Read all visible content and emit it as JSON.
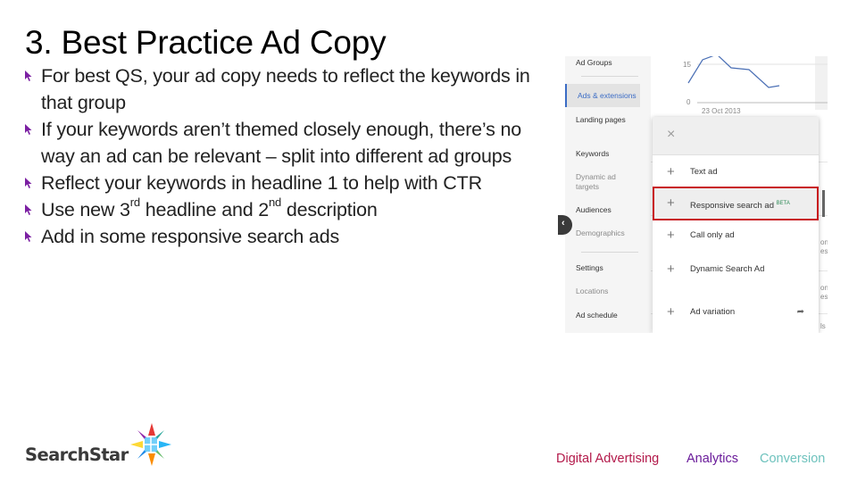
{
  "slide": {
    "title": "3. Best Practice Ad Copy",
    "bullet_color": "#7b1fa2",
    "bullets": [
      {
        "text": "For best QS, your ad copy needs to reflect the keywords in that group"
      },
      {
        "text": "If your keywords aren’t themed closely enough, there’s no way an ad can be relevant – split into different ad groups"
      },
      {
        "text": "Reflect your keywords in headline 1 to help with CTR"
      },
      {
        "pre": "Use new 3",
        "sup1": "rd",
        "mid": " headline and 2",
        "sup2": "nd",
        "post": " description"
      },
      {
        "text": "Add in some responsive search ads"
      }
    ]
  },
  "screenshot": {
    "sidebar": {
      "items": [
        {
          "label": "Ad Groups"
        },
        {
          "label": "Ads & extensions",
          "active": true
        },
        {
          "label": "Landing pages"
        },
        {
          "label": "Keywords"
        },
        {
          "label": "Dynamic ad targets"
        },
        {
          "label": "Audiences"
        },
        {
          "label": "Demographics"
        },
        {
          "label": "Settings"
        },
        {
          "label": "Locations"
        },
        {
          "label": "Ad schedule"
        }
      ]
    },
    "chart": {
      "y_ticks": [
        "15",
        "0"
      ],
      "x_label": "23 Oct 2013",
      "line_color": "#4a6fb5"
    },
    "right_col_fragments": [
      "on",
      "es",
      "on",
      "es",
      "ls"
    ],
    "dialog": {
      "close_icon": "×",
      "options": [
        {
          "label": "Text ad"
        },
        {
          "label": "Responsive search ad",
          "badge": "BETA",
          "highlighted": true
        },
        {
          "label": "Call only ad"
        },
        {
          "label": "Dynamic Search Ad"
        },
        {
          "label": "Ad variation",
          "trailing_icon": "share-arrow"
        }
      ],
      "highlight_color": "#c8171e"
    },
    "collapse_icon": "‹"
  },
  "logo": {
    "text": "SearchStar"
  },
  "footer": {
    "items": [
      {
        "label": "Digital Advertising",
        "color": "#b3194a"
      },
      {
        "label": "Analytics",
        "color": "#6a1b9a"
      },
      {
        "label": "Conversion",
        "color": "#6ec2bd"
      }
    ]
  }
}
